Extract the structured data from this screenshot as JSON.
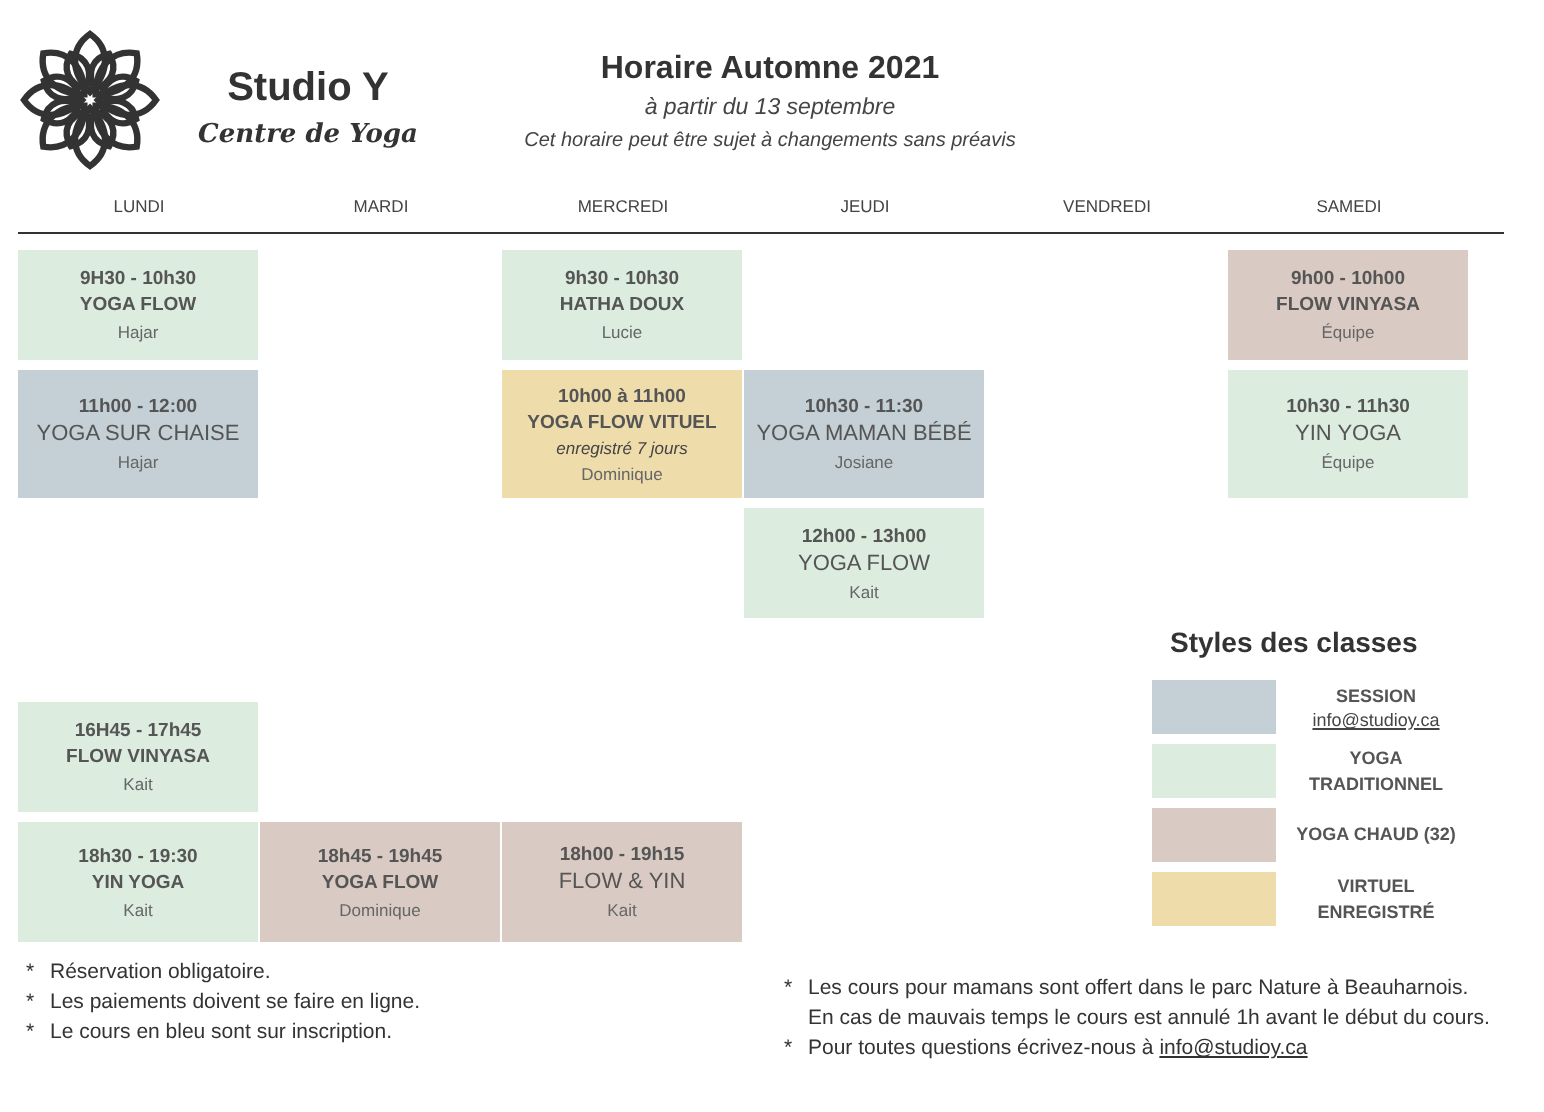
{
  "brand": {
    "name": "Studio Y",
    "tagline": "Centre de Yoga"
  },
  "header": {
    "title": "Horaire Automne 2021",
    "subtitle": "à partir du 13 septembre",
    "note": "Cet horaire peut être sujet à changements sans préavis"
  },
  "days": [
    "LUNDI",
    "MARDI",
    "MERCREDI",
    "JEUDI",
    "VENDREDI",
    "SAMEDI"
  ],
  "rows": [
    {
      "cells": [
        {
          "kind": "class",
          "color": "#dcecdf",
          "time": "9H30 - 10h30",
          "name": "YOGA FLOW",
          "bold": true,
          "teacher": "Hajar"
        },
        {
          "kind": "empty"
        },
        {
          "kind": "class",
          "color": "#dcecdf",
          "time": "9h30 - 10h30",
          "name": "HATHA DOUX",
          "bold": true,
          "teacher": "Lucie"
        },
        {
          "kind": "empty"
        },
        {
          "kind": "empty"
        },
        {
          "kind": "class",
          "color": "#d9cbc3",
          "time": "9h00  - 10h00",
          "name": "FLOW  VINYASA",
          "bold": true,
          "teacher": "Équipe"
        }
      ]
    },
    {
      "cells": [
        {
          "kind": "class",
          "color": "#c4d0d6",
          "time": "11h00 - 12:00",
          "name": "YOGA SUR CHAISE",
          "bold": false,
          "teacher": "Hajar"
        },
        {
          "kind": "empty"
        },
        {
          "kind": "class",
          "color": "#eedcaa",
          "time": "10h00 à 11h00",
          "name": "YOGA FLOW VITUEL",
          "bold": true,
          "note": "enregistré 7 jours",
          "teacher": "Dominique"
        },
        {
          "kind": "class",
          "color": "#c4d0d6",
          "time": "10h30 - 11:30",
          "name": "YOGA MAMAN BÉBÉ",
          "bold": false,
          "teacher": "Josiane"
        },
        {
          "kind": "empty"
        },
        {
          "kind": "class",
          "color": "#dcecdf",
          "time": "10h30 - 11h30",
          "name": "YIN YOGA",
          "bold": false,
          "teacher": "Équipe"
        }
      ]
    },
    {
      "cells": [
        {
          "kind": "empty"
        },
        {
          "kind": "empty"
        },
        {
          "kind": "empty"
        },
        {
          "kind": "class",
          "color": "#dcecdf",
          "time": "12h00 - 13h00",
          "name": "YOGA FLOW",
          "bold": false,
          "teacher": "Kait"
        },
        {
          "kind": "empty"
        },
        {
          "kind": "empty"
        }
      ]
    },
    {
      "cells": [
        {
          "kind": "class",
          "color": "#dcecdf",
          "time": "16H45 - 17h45",
          "name": "FLOW VINYASA",
          "bold": true,
          "teacher": "Kait"
        },
        {
          "kind": "empty"
        },
        {
          "kind": "empty"
        },
        {
          "kind": "empty"
        }
      ]
    },
    {
      "cells": [
        {
          "kind": "class",
          "color": "#dcecdf",
          "time": "18h30 - 19:30",
          "name": "YIN YOGA",
          "bold": true,
          "teacher": "Kait"
        },
        {
          "kind": "class",
          "color": "#d9cbc3",
          "time": "18h45 - 19h45",
          "name": "YOGA FLOW",
          "bold": true,
          "teacher": "Dominique"
        },
        {
          "kind": "class",
          "color": "#d9cbc3",
          "time": "18h00 - 19h15",
          "name": "FLOW & YIN",
          "bold": false,
          "teacher": "Kait"
        },
        {
          "kind": "empty"
        }
      ]
    }
  ],
  "legend": {
    "title": "Styles des classes",
    "items": [
      {
        "color": "#c4d0d6",
        "label": "SESSION",
        "link": "info@studioy.ca"
      },
      {
        "color": "#dcecdf",
        "label": "YOGA TRADITIONNEL"
      },
      {
        "color": "#d9cbc3",
        "label": "YOGA CHAUD (32)"
      },
      {
        "color": "#eedcaa",
        "label": "VIRTUEL ENREGISTRÉ"
      }
    ]
  },
  "notes_left": [
    {
      "mark": "*",
      "text": "Réservation obligatoire."
    },
    {
      "mark": "*",
      "text": "Les paiements doivent se faire en ligne."
    },
    {
      "mark": "*",
      "text": "Le cours en bleu sont sur inscription."
    }
  ],
  "notes_right": [
    {
      "mark": "*",
      "lines": [
        "Les cours pour mamans sont offert dans le parc Nature à Beauharnois.",
        "En cas de mauvais temps le cours est annulé 1h avant le début du cours."
      ]
    },
    {
      "mark": "*",
      "lines": [
        "Pour toutes questions écrivez-nous à "
      ],
      "link": "info@studioy.ca"
    }
  ]
}
